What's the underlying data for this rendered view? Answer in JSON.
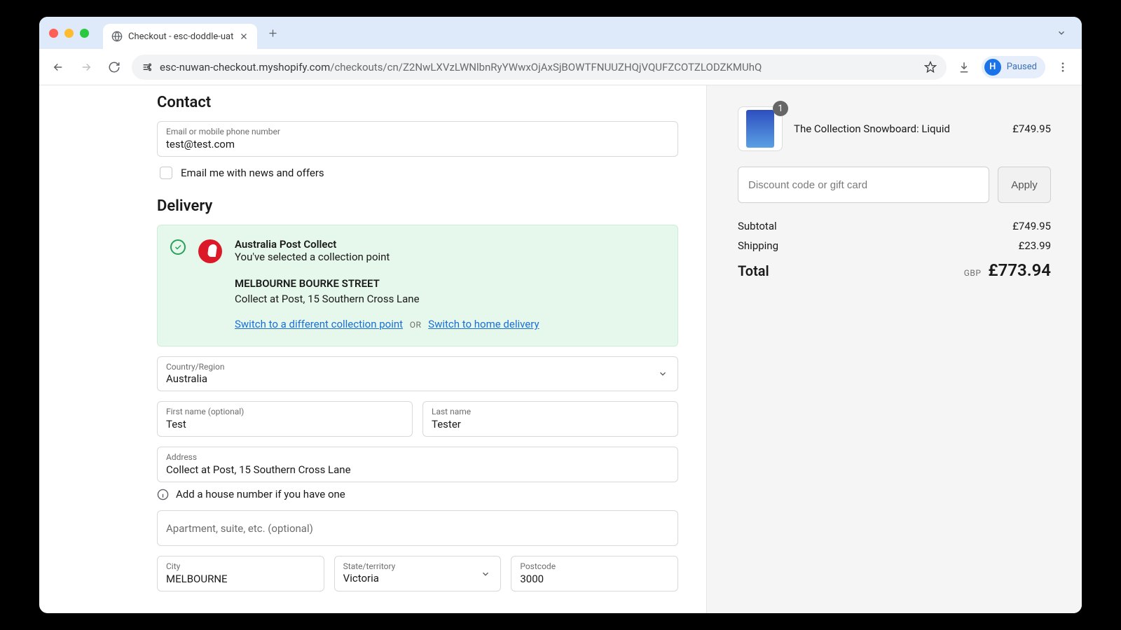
{
  "browser": {
    "tab_title": "Checkout - esc-doddle-uat",
    "url_host": "esc-nuwan-checkout.myshopify.com",
    "url_path": "/checkouts/cn/Z2NwLXVzLWNlbnRyYWwxOjAxSjBOWTFNUUZHQjVQUFZCOTZLODZKMUhQ",
    "profile_status": "Paused",
    "profile_initial": "H"
  },
  "contact": {
    "heading": "Contact",
    "email_label": "Email or mobile phone number",
    "email_value": "test@test.com",
    "subscribe_label": "Email me with news and offers"
  },
  "delivery": {
    "heading": "Delivery",
    "collection": {
      "provider": "Australia Post Collect",
      "subtitle": "You've selected a collection point",
      "location_name": "MELBOURNE BOURKE STREET",
      "location_address": "Collect at Post, 15 Southern Cross Lane",
      "switch_point_link": "Switch to a different collection point",
      "or_text": "OR",
      "switch_home_link": "Switch to home delivery"
    },
    "country_label": "Country/Region",
    "country_value": "Australia",
    "first_name_label": "First name (optional)",
    "first_name_value": "Test",
    "last_name_label": "Last name",
    "last_name_value": "Tester",
    "address_label": "Address",
    "address_value": "Collect at Post, 15 Southern Cross Lane",
    "address_hint": "Add a house number if you have one",
    "apt_placeholder": "Apartment, suite, etc. (optional)",
    "city_label": "City",
    "city_value": "MELBOURNE",
    "state_label": "State/territory",
    "state_value": "Victoria",
    "postcode_label": "Postcode",
    "postcode_value": "3000"
  },
  "summary": {
    "item": {
      "qty": "1",
      "name": "The Collection Snowboard: Liquid",
      "price": "£749.95"
    },
    "discount_placeholder": "Discount code or gift card",
    "apply_label": "Apply",
    "subtotal_label": "Subtotal",
    "subtotal_value": "£749.95",
    "shipping_label": "Shipping",
    "shipping_value": "£23.99",
    "total_label": "Total",
    "total_currency": "GBP",
    "total_value": "£773.94"
  }
}
